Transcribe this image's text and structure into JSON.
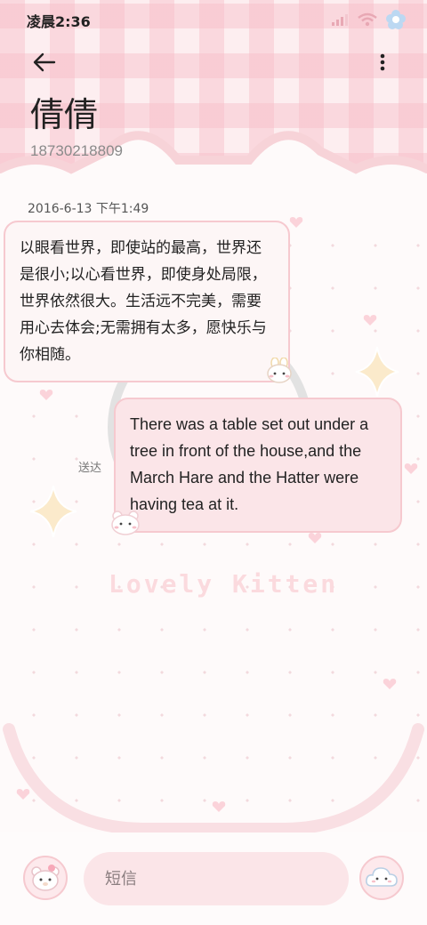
{
  "status_bar": {
    "time": "凌晨2:36"
  },
  "header": {
    "contact_name": "倩倩",
    "contact_number": "18730218809"
  },
  "conversation": {
    "date": "2016-6-13 下午1:49",
    "messages": [
      {
        "direction": "incoming",
        "text": "以眼看世界，即使站的最高，世界还是很小;以心看世界，即使身处局限，世界依然很大。生活远不完美，需要用心去体会;无需拥有太多，愿快乐与你相随。"
      },
      {
        "direction": "outgoing",
        "text": "There was a table set out under a tree in front of the house,and the March Hare and the Hatter were having tea at it.",
        "status": "送达"
      }
    ]
  },
  "decorations": {
    "watermark_text": "Lovely Kitten"
  },
  "composer": {
    "placeholder": "短信"
  },
  "colors": {
    "accent_pink": "#f6c9cf",
    "bubble_out_fill": "#fbe5e8",
    "bubble_in_fill": "#fdf6f6"
  },
  "icons": [
    "back-arrow-icon",
    "more-vert-icon",
    "signal-icon",
    "wifi-icon",
    "flower-icon",
    "bunny-sticker-icon",
    "bear-avatar-icon",
    "cloud-send-icon",
    "sparkle-icon"
  ]
}
